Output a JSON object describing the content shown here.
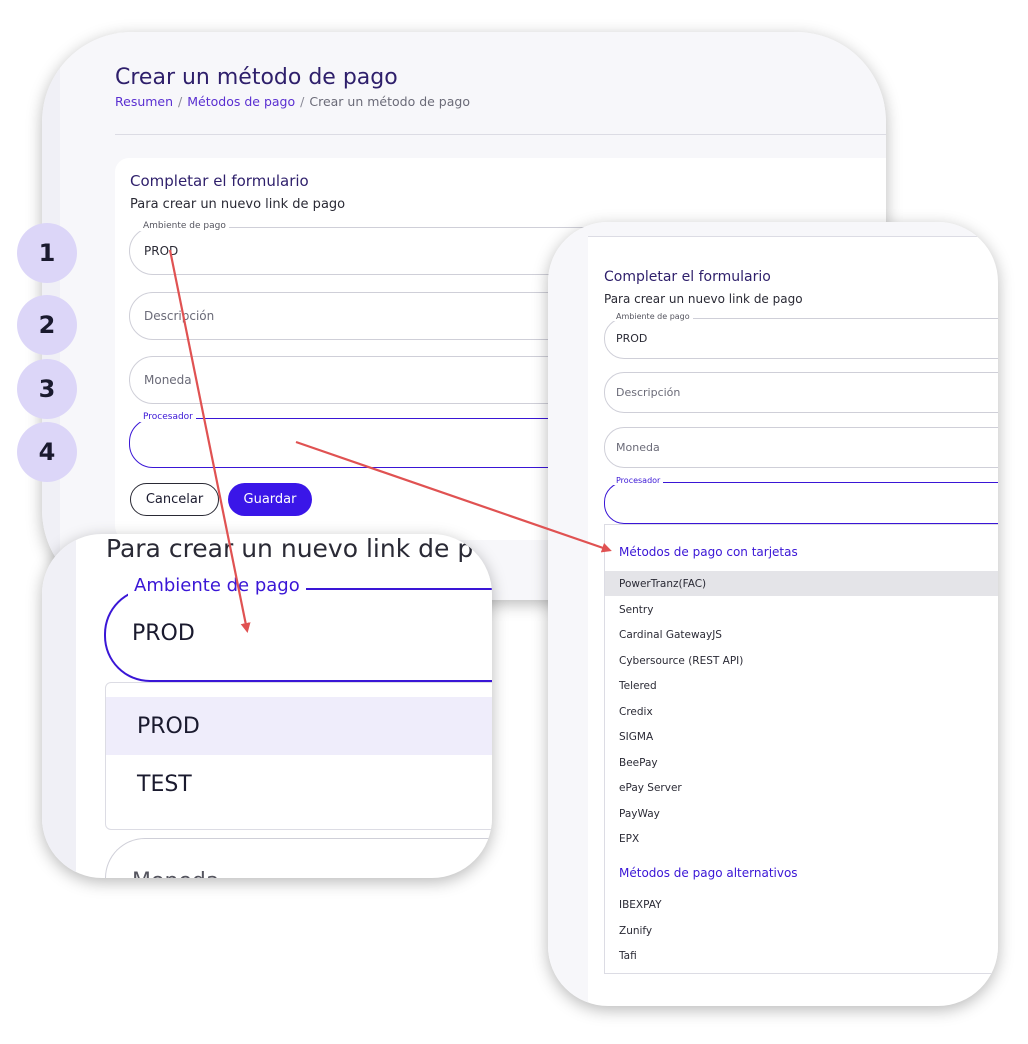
{
  "page": {
    "title": "Crear un método de pago",
    "breadcrumb": [
      "Resumen",
      "Métodos de pago",
      "Crear un método de pago"
    ]
  },
  "form": {
    "heading": "Completar el formulario",
    "subheading": "Para crear un nuevo link de pago",
    "fields": {
      "ambiente_label": "Ambiente de pago",
      "ambiente_value": "PROD",
      "descripcion_placeholder": "Descripción",
      "moneda_placeholder": "Moneda",
      "procesador_label": "Procesador"
    },
    "buttons": {
      "cancel": "Cancelar",
      "save": "Guardar"
    }
  },
  "steps": [
    "1",
    "2",
    "3",
    "4"
  ],
  "zoom": {
    "subheading": "Para crear un nuevo link de p",
    "label": "Ambiente de pago",
    "value": "PROD",
    "options": [
      "PROD",
      "TEST"
    ],
    "selected": "PROD",
    "next_field_placeholder": "Moneda"
  },
  "processor_dropdown": {
    "groups": [
      {
        "title": "Métodos de pago con tarjetas",
        "options": [
          "PowerTranz(FAC)",
          "Sentry",
          "Cardinal GatewayJS",
          "Cybersource (REST API)",
          "Telered",
          "Credix",
          "SIGMA",
          "BeePay",
          "ePay Server",
          "PayWay",
          "EPX"
        ]
      },
      {
        "title": "Métodos de pago alternativos",
        "options": [
          "IBEXPAY",
          "Zunify",
          "Tafi"
        ]
      }
    ],
    "highlighted": "PowerTranz(FAC)"
  },
  "colors": {
    "accent": "#3a16e8",
    "step_bg": "#dcd6f8",
    "arrow": "#e05252"
  }
}
